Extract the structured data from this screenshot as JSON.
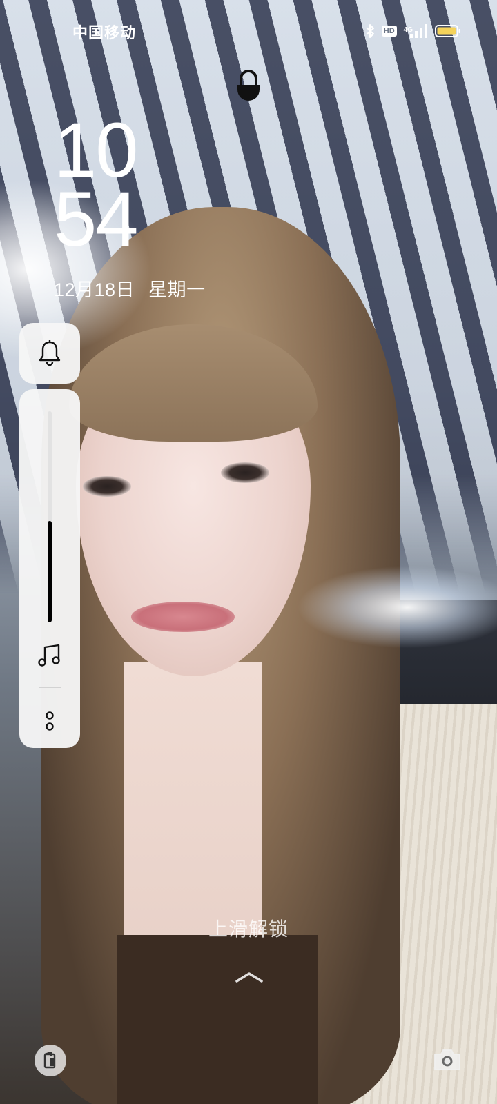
{
  "status_bar": {
    "carrier": "中国移动",
    "hd_label": "HD",
    "network_label": "4G",
    "battery_color": "#f5d35b",
    "icons": [
      "bluetooth-icon",
      "hd-icon",
      "signal-icon",
      "battery-icon"
    ]
  },
  "lock_screen": {
    "hour": "10",
    "minute": "54",
    "date": "12月18日",
    "weekday": "星期一",
    "swipe_hint": "上滑解锁"
  },
  "volume_panel": {
    "ringer_mode_icon": "bell-icon",
    "media_icon": "music-note-icon",
    "more_icon": "more-options-icon",
    "level": 0.48
  },
  "shortcuts": {
    "left": "wallet-icon",
    "right": "camera-icon"
  },
  "colors": {
    "text": "#ffffff",
    "panel_bg": "#f6f6f6",
    "slider_fill": "#000000",
    "slider_track": "#e2e2e2"
  }
}
